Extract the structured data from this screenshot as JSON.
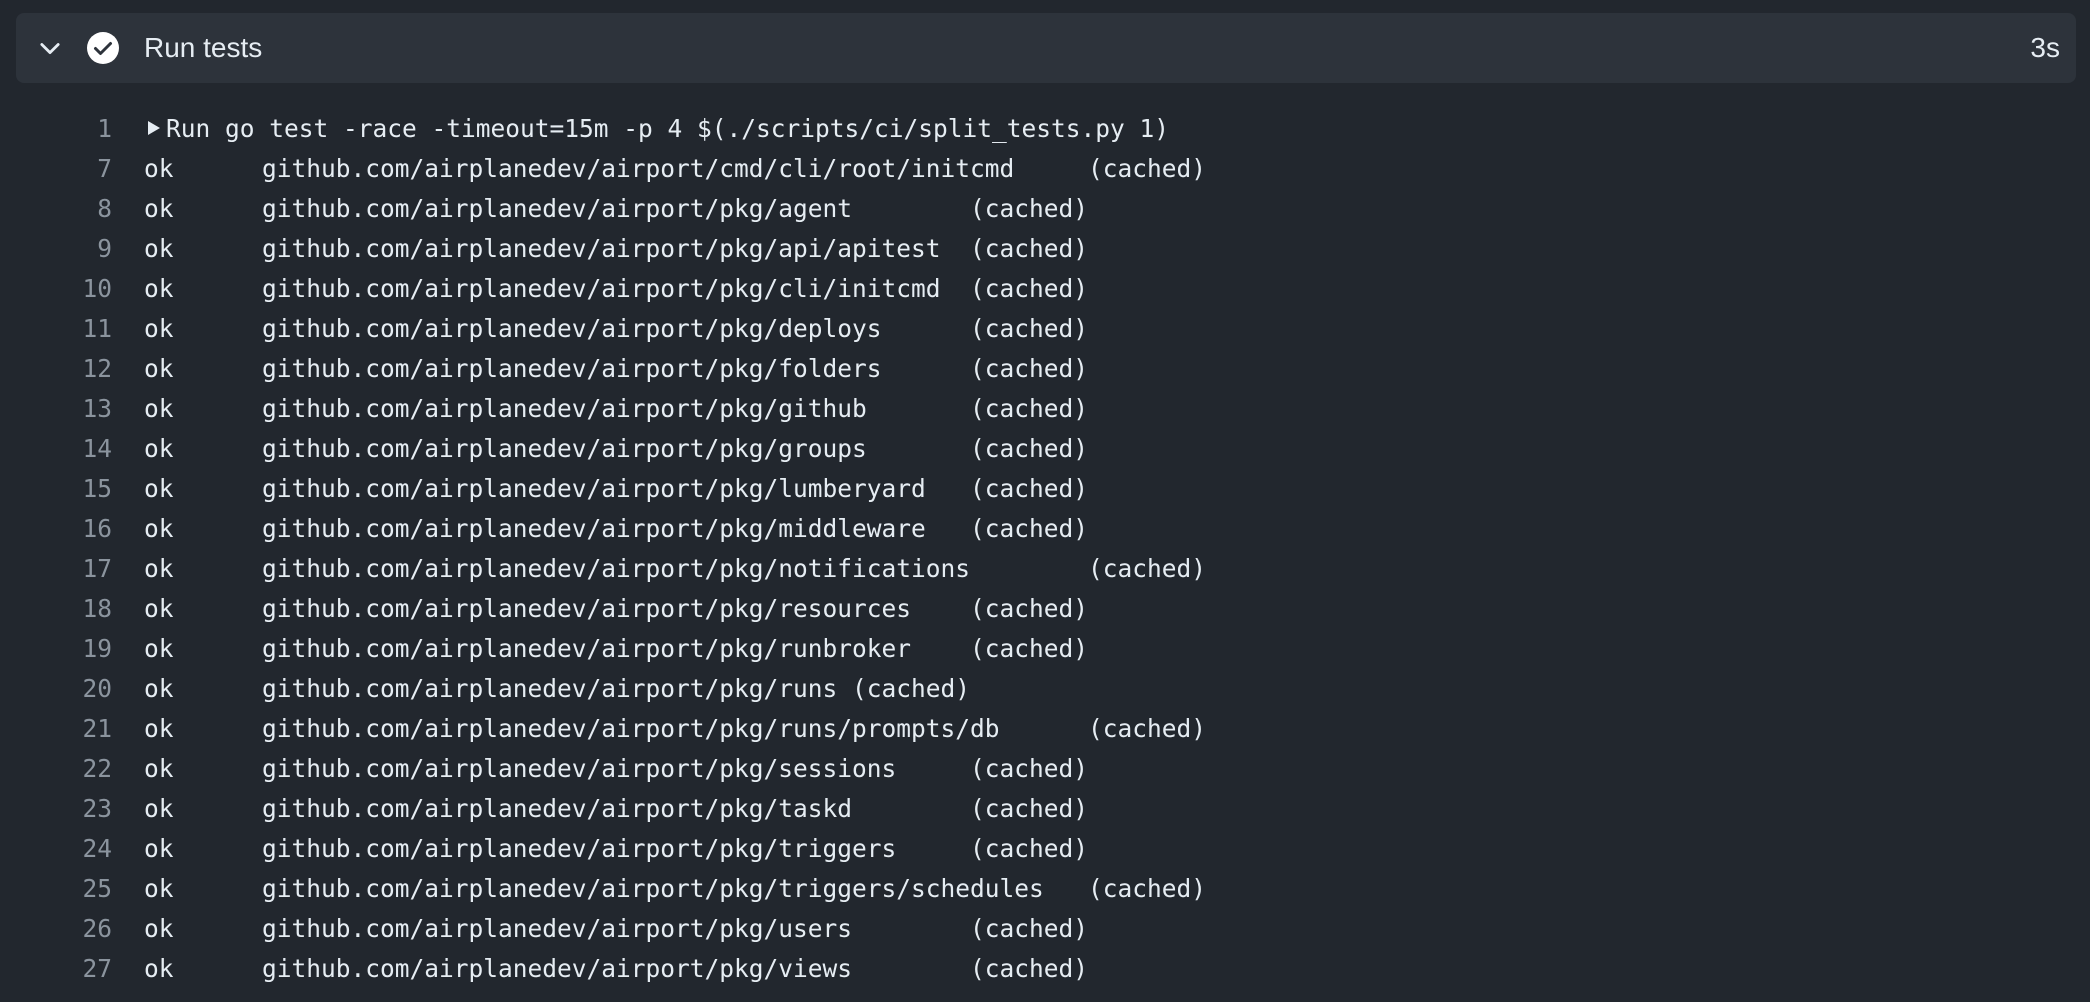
{
  "step": {
    "title": "Run tests",
    "duration": "3s",
    "status_color": "#ffffff"
  },
  "log": [
    {
      "num": "1",
      "text": "Run go test -race -timeout=15m -p 4 $(./scripts/ci/split_tests.py 1)",
      "collapsible": true
    },
    {
      "num": "7",
      "text": "ok  \tgithub.com/airplanedev/airport/cmd/cli/root/initcmd\t(cached)"
    },
    {
      "num": "8",
      "text": "ok  \tgithub.com/airplanedev/airport/pkg/agent\t(cached)"
    },
    {
      "num": "9",
      "text": "ok  \tgithub.com/airplanedev/airport/pkg/api/apitest\t(cached)"
    },
    {
      "num": "10",
      "text": "ok  \tgithub.com/airplanedev/airport/pkg/cli/initcmd\t(cached)"
    },
    {
      "num": "11",
      "text": "ok  \tgithub.com/airplanedev/airport/pkg/deploys\t(cached)"
    },
    {
      "num": "12",
      "text": "ok  \tgithub.com/airplanedev/airport/pkg/folders\t(cached)"
    },
    {
      "num": "13",
      "text": "ok  \tgithub.com/airplanedev/airport/pkg/github\t(cached)"
    },
    {
      "num": "14",
      "text": "ok  \tgithub.com/airplanedev/airport/pkg/groups\t(cached)"
    },
    {
      "num": "15",
      "text": "ok  \tgithub.com/airplanedev/airport/pkg/lumberyard\t(cached)"
    },
    {
      "num": "16",
      "text": "ok  \tgithub.com/airplanedev/airport/pkg/middleware\t(cached)"
    },
    {
      "num": "17",
      "text": "ok  \tgithub.com/airplanedev/airport/pkg/notifications\t(cached)"
    },
    {
      "num": "18",
      "text": "ok  \tgithub.com/airplanedev/airport/pkg/resources\t(cached)"
    },
    {
      "num": "19",
      "text": "ok  \tgithub.com/airplanedev/airport/pkg/runbroker\t(cached)"
    },
    {
      "num": "20",
      "text": "ok  \tgithub.com/airplanedev/airport/pkg/runs\t(cached)"
    },
    {
      "num": "21",
      "text": "ok  \tgithub.com/airplanedev/airport/pkg/runs/prompts/db\t(cached)"
    },
    {
      "num": "22",
      "text": "ok  \tgithub.com/airplanedev/airport/pkg/sessions\t(cached)"
    },
    {
      "num": "23",
      "text": "ok  \tgithub.com/airplanedev/airport/pkg/taskd\t(cached)"
    },
    {
      "num": "24",
      "text": "ok  \tgithub.com/airplanedev/airport/pkg/triggers\t(cached)"
    },
    {
      "num": "25",
      "text": "ok  \tgithub.com/airplanedev/airport/pkg/triggers/schedules\t(cached)"
    },
    {
      "num": "26",
      "text": "ok  \tgithub.com/airplanedev/airport/pkg/users\t(cached)"
    },
    {
      "num": "27",
      "text": "ok  \tgithub.com/airplanedev/airport/pkg/views\t(cached)"
    }
  ]
}
